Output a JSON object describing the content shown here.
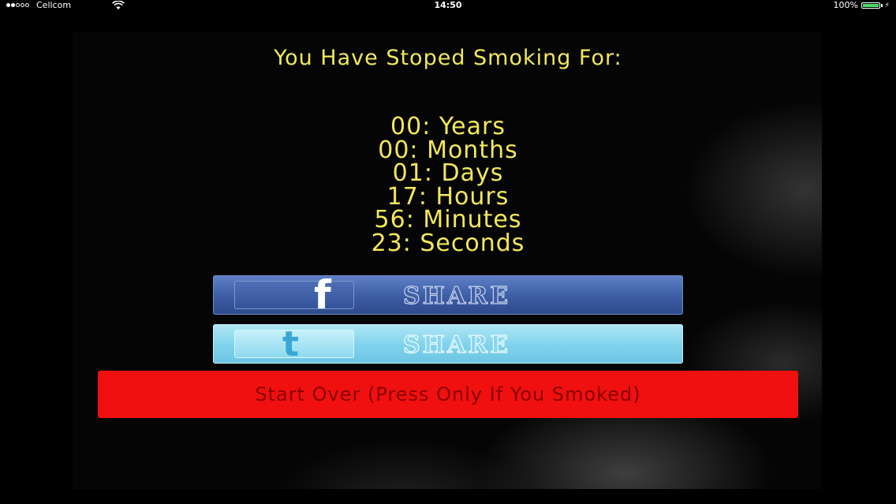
{
  "status_bar": {
    "signal_full": 2,
    "signal_total": 5,
    "carrier": "Cellcom",
    "time": "14:50",
    "battery": "100%",
    "battery_level": 1.0,
    "battery_color": "#4cd964"
  },
  "headline": "You Have Stoped Smoking For:",
  "counter": {
    "years": "00: Years",
    "months": "00: Months",
    "days": "01: Days",
    "hours": "17: Hours",
    "minutes": "56: Minutes",
    "seconds": "23: Seconds"
  },
  "share": {
    "facebook": {
      "icon": "facebook-icon",
      "glyph": "f",
      "label": "SHARE",
      "color": "#3c5ca3"
    },
    "twitter": {
      "icon": "twitter-icon",
      "glyph": "t",
      "label": "SHARE",
      "color": "#7fd2ec"
    }
  },
  "start_over": {
    "label": "Start Over (Press Only If You Smoked)",
    "color": "#f01010"
  },
  "colors": {
    "text_accent": "#f2e85a",
    "background": "#000000"
  }
}
